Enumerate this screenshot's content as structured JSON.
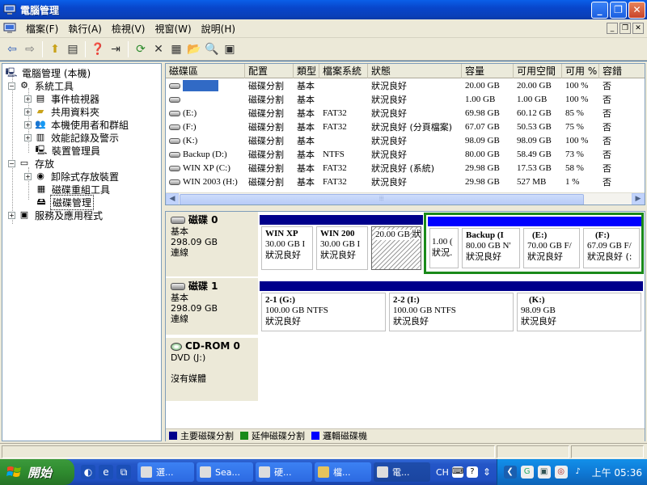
{
  "window": {
    "title": "電腦管理",
    "minimize_glyph": "_",
    "maximize_glyph": "❐",
    "close_glyph": "✕"
  },
  "menu": {
    "items": [
      "檔案(F)",
      "執行(A)",
      "檢視(V)",
      "視窗(W)",
      "說明(H)"
    ],
    "mdi_minimize": "_",
    "mdi_restore": "❐",
    "mdi_close": "✕"
  },
  "toolbar": {
    "icons": [
      "back-arrow-icon",
      "forward-arrow-icon",
      "up-folder-icon",
      "show-hide-tree-icon",
      "properties-icon",
      "export-list-icon",
      "refresh-icon",
      "delete-icon",
      "properties-sheet-icon",
      "open-folder-icon",
      "search-icon",
      "help-icon"
    ],
    "glyphs": {
      "back": "⇦",
      "forward": "⇨",
      "up": "⬆",
      "tree": "▤",
      "help_topic": "❓",
      "export": "⇥",
      "refresh": "⟳",
      "delete": "✕",
      "props": "▦",
      "open": "📂",
      "find": "🔍",
      "help": "▣"
    }
  },
  "tree": {
    "root": "電腦管理 (本機)",
    "system_tools": "系統工具",
    "event_viewer": "事件檢視器",
    "shared_folders": "共用資料夾",
    "local_users": "本機使用者和群組",
    "perf_logs": "效能記錄及警示",
    "device_manager": "裝置管理員",
    "storage": "存放",
    "removable_storage": "卸除式存放裝置",
    "defrag": "磁碟重組工具",
    "disk_mgmt": "磁碟管理",
    "services": "服務及應用程式",
    "expand_plus": "+",
    "expand_minus": "−"
  },
  "volumes": {
    "columns": [
      "磁碟區",
      "配置",
      "類型",
      "檔案系統",
      "狀態",
      "容量",
      "可用空間",
      "可用 %",
      "容錯"
    ],
    "rows": [
      {
        "name": "",
        "layout": "磁碟分割",
        "type": "基本",
        "fs": "",
        "status": "狀況良好",
        "capacity": "20.00 GB",
        "free": "20.00 GB",
        "pct": "100 %",
        "ft": "否"
      },
      {
        "name": "",
        "layout": "磁碟分割",
        "type": "基本",
        "fs": "",
        "status": "狀況良好",
        "capacity": "1.00 GB",
        "free": "1.00 GB",
        "pct": "100 %",
        "ft": "否"
      },
      {
        "name": "(E:)",
        "layout": "磁碟分割",
        "type": "基本",
        "fs": "FAT32",
        "status": "狀況良好",
        "capacity": "69.98 GB",
        "free": "60.12 GB",
        "pct": "85 %",
        "ft": "否"
      },
      {
        "name": "(F:)",
        "layout": "磁碟分割",
        "type": "基本",
        "fs": "FAT32",
        "status": "狀況良好 (分頁檔案)",
        "capacity": "67.07 GB",
        "free": "50.53 GB",
        "pct": "75 %",
        "ft": "否"
      },
      {
        "name": "(K:)",
        "layout": "磁碟分割",
        "type": "基本",
        "fs": "",
        "status": "狀況良好",
        "capacity": "98.09 GB",
        "free": "98.09 GB",
        "pct": "100 %",
        "ft": "否"
      },
      {
        "name": "Backup (D:)",
        "layout": "磁碟分割",
        "type": "基本",
        "fs": "NTFS",
        "status": "狀況良好",
        "capacity": "80.00 GB",
        "free": "58.49 GB",
        "pct": "73 %",
        "ft": "否"
      },
      {
        "name": "WIN XP (C:)",
        "layout": "磁碟分割",
        "type": "基本",
        "fs": "FAT32",
        "status": "狀況良好 (系統)",
        "capacity": "29.98 GB",
        "free": "17.53 GB",
        "pct": "58 %",
        "ft": "否"
      },
      {
        "name": "WIN 2003 (H:)",
        "layout": "磁碟分割",
        "type": "基本",
        "fs": "FAT32",
        "status": "狀況良好",
        "capacity": "29.98 GB",
        "free": "527 MB",
        "pct": "1 %",
        "ft": "否"
      }
    ],
    "scroll_left": "◀",
    "scroll_right": "▶",
    "scroll_grip": "⦙⦙⦙"
  },
  "disks": {
    "disk0": {
      "name": "磁碟 0",
      "type": "基本",
      "size": "298.09 GB",
      "status": "連線",
      "partitions": [
        {
          "title": "WIN XP",
          "size": "30.00 GB I",
          "status": "狀況良好"
        },
        {
          "title": "WIN 200",
          "size": "30.00 GB I",
          "status": "狀況良好"
        },
        {
          "title": "",
          "size": "20.00 GB",
          "status": "狀況良好"
        },
        {
          "title": "",
          "size": "1.00 (",
          "status": "狀況."
        },
        {
          "title": "Backup  (I",
          "size": "80.00 GB N'",
          "status": "狀況良好"
        },
        {
          "title": "(E:)",
          "size": "70.00 GB F/",
          "status": "狀況良好"
        },
        {
          "title": "(F:)",
          "size": "67.09 GB F/",
          "status": "狀況良好 (:"
        }
      ]
    },
    "disk1": {
      "name": "磁碟 1",
      "type": "基本",
      "size": "298.09 GB",
      "status": "連線",
      "partitions": [
        {
          "title": "2-1  (G:)",
          "size": "100.00 GB NTFS",
          "status": "狀況良好"
        },
        {
          "title": "2-2  (I:)",
          "size": "100.00 GB NTFS",
          "status": "狀況良好"
        },
        {
          "title": "(K:)",
          "size": "98.09 GB",
          "status": "狀況良好"
        }
      ]
    },
    "cdrom": {
      "name": "CD-ROM 0",
      "type": "DVD (J:)",
      "status": "沒有媒體"
    }
  },
  "legend": {
    "primary": "主要磁碟分割",
    "extended": "延伸磁碟分割",
    "logical": "邏輯磁碟機",
    "primary_color": "#00008b",
    "extended_color": "#1a8a1a",
    "logical_color": "#0000ff"
  },
  "taskbar": {
    "start": "開始",
    "tasks": [
      "選...",
      "Sea...",
      "硬...",
      "檔...",
      "電..."
    ],
    "language": "CH",
    "clock": "上午 05:36"
  }
}
